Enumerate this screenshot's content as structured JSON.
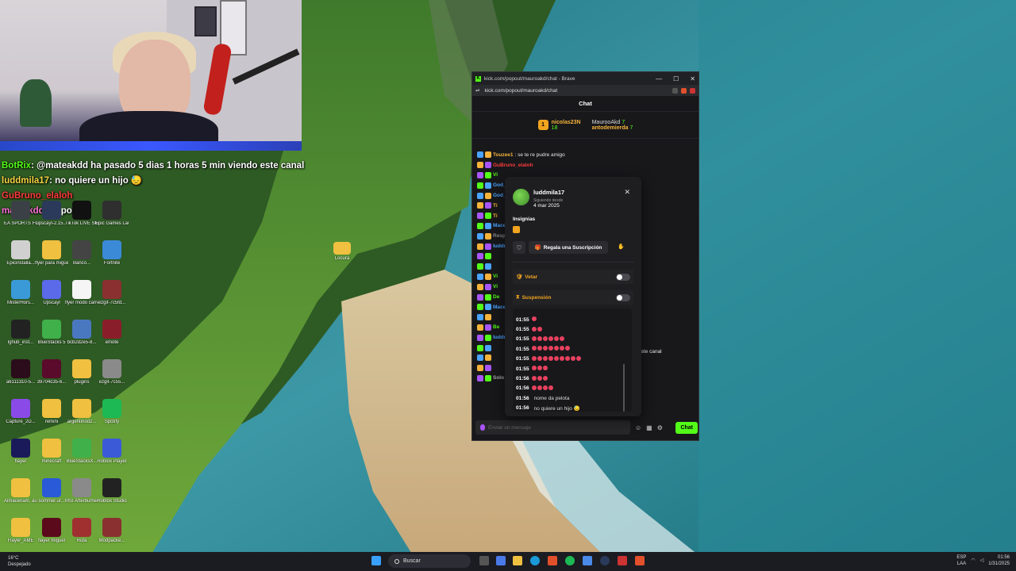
{
  "overlay_chat": [
    {
      "user": "BotRix",
      "text": ": @mateakdd ha pasado 5 dias 1 horas 5 min viendo este canal",
      "cls": "user-botrix"
    },
    {
      "user": "luddmila17",
      "text": ": no quiere un hijo 😓",
      "cls": "user-ludd"
    },
    {
      "user": "GuBruno_elaloh",
      "text": "",
      "cls": "user-bruno"
    },
    {
      "user": "mateakdd",
      "text": ": re pocco",
      "cls": "user-matea"
    }
  ],
  "desktop_icons": [
    {
      "label": "EA SPORTS FC 25",
      "color": "#3a4046"
    },
    {
      "label": "upscayl-2.15...",
      "color": "#2b3a5a"
    },
    {
      "label": "TikTok LIVE Studio",
      "color": "#111111"
    },
    {
      "label": "Epic Games Launcher",
      "color": "#2f2f2f"
    },
    {
      "label": "Epicinstalla...",
      "color": "#d0d0d0"
    },
    {
      "label": "flyer para miguel",
      "color": "#f0c040"
    },
    {
      "label": "Banco...",
      "color": "#444444"
    },
    {
      "label": "Fortnite",
      "color": "#3a8ad8"
    },
    {
      "label": "MisterHors...",
      "color": "#3a9ad8"
    },
    {
      "label": "Upscayl",
      "color": "#5a6ae8"
    },
    {
      "label": "flyer modo carrera",
      "color": "#f5f5f5"
    },
    {
      "label": "ezgif-7c5fd...",
      "color": "#8a3030"
    },
    {
      "label": "lghub_inst...",
      "color": "#222222"
    },
    {
      "label": "BlueStacks 5",
      "color": "#3fb04a"
    },
    {
      "label": "bcb2d2e5-8...",
      "color": "#4a78c0"
    },
    {
      "label": "emote",
      "color": "#8a1d2a"
    },
    {
      "label": "a6111310-5...",
      "color": "#2a0c1a"
    },
    {
      "label": "39704c35-6...",
      "color": "#5a0a2a"
    },
    {
      "label": "plugins",
      "color": "#f0c040"
    },
    {
      "label": "ezgif-7c55...",
      "color": "#8a8a8a"
    },
    {
      "label": "Capture_2D...",
      "color": "#8a4ae8"
    },
    {
      "label": "remini",
      "color": "#f0c040"
    },
    {
      "label": "argentinod2...",
      "color": "#f0c040"
    },
    {
      "label": "Spotify",
      "color": "#1db954"
    },
    {
      "label": "flayer",
      "color": "#1a1a5a"
    },
    {
      "label": "minecraft",
      "color": "#f0c040"
    },
    {
      "label": "BlueStacksX...",
      "color": "#3fb04a"
    },
    {
      "label": "Roblox Player",
      "color": "#3a5ad8"
    },
    {
      "label": "Almacenam. automatic...",
      "color": "#f0c040"
    },
    {
      "label": "sommer.ur...",
      "color": "#2a5ad8"
    },
    {
      "label": "MSI Afterburner",
      "color": "#8a8a8a"
    },
    {
      "label": "Roblox Studio",
      "color": "#222222"
    },
    {
      "label": "Flayer_AME",
      "color": "#f0c040"
    },
    {
      "label": "flayer miguel",
      "color": "#5a0a1a"
    },
    {
      "label": "Ruta",
      "color": "#a03030"
    },
    {
      "label": "Modpacke...",
      "color": "#8a3030"
    }
  ],
  "folder_label": "Locura",
  "browser": {
    "title": "kick.com/popout/mauroakd/chat - Brave",
    "logo": "K",
    "min": "—",
    "max": "☐",
    "close": "✕",
    "address": "kick.com/popout/mauroakd/chat",
    "tune_icon": "⇌",
    "chat_header": "Chat",
    "leader_rank": "1",
    "leader_name": "nicolas23N",
    "leader_count": "18",
    "second_name": "MaurooAkd",
    "second_count": "7",
    "third_name": "antodemierda",
    "third_count": "7"
  },
  "chat_messages": [
    {
      "user": "Touzee1",
      "text": ": se te re pudre amigo",
      "color": "#f5b33a"
    },
    {
      "user": "GuBruno_elaloh",
      "text": "",
      "color": "#ff3a3a"
    },
    {
      "user": "Vi",
      "text": "",
      "color": "#53fc18"
    },
    {
      "user": "God_anz",
      "text": "",
      "color": "#4aa3ff"
    },
    {
      "user": "God_anz",
      "text": "",
      "color": "#4aa3ff"
    },
    {
      "user": "Ti",
      "text": "",
      "color": "#f5b33a"
    },
    {
      "user": "Ti",
      "text": "",
      "color": "#f5b33a"
    },
    {
      "user": "Macelli",
      "text": "",
      "color": "#4aa3ff"
    },
    {
      "user": "Respo",
      "text": "",
      "color": "#888888"
    },
    {
      "user": "luddmi",
      "text": "",
      "color": "#4aa3ff"
    },
    {
      "user": "",
      "text": "",
      "color": "#4aa3ff"
    },
    {
      "user": "",
      "text": "",
      "color": "#f5b33a"
    },
    {
      "user": "Vi",
      "text": "",
      "color": "#53fc18"
    },
    {
      "user": "Vi",
      "text": "",
      "color": "#53fc18"
    },
    {
      "user": "De",
      "text": "",
      "color": "#53fc18"
    },
    {
      "user": "Macelli",
      "text": "",
      "color": "#4aa3ff"
    },
    {
      "user": "",
      "text": "",
      "color": "#4aa3ff"
    },
    {
      "user": "Be",
      "text": "",
      "color": "#53fc18"
    },
    {
      "user": "luddmi",
      "text": "",
      "color": "#4aa3ff"
    },
    {
      "user": "",
      "text": "",
      "color": "#f5b33a"
    },
    {
      "user": "",
      "text": "",
      "color": "#53fc18"
    },
    {
      "user": "",
      "text": "",
      "color": "#4aa3ff"
    },
    {
      "user": "Solo seg",
      "text": "",
      "color": "#aaaaaa"
    }
  ],
  "chat_extra": "este canal",
  "chat_input": {
    "placeholder": "Enviar un mensaje",
    "send": "Chat",
    "ico_emote": "☺",
    "ico_store": "▦",
    "ico_gear": "⚙"
  },
  "usercard": {
    "username": "luddmila17",
    "follow_label": "Siguiendo desde",
    "follow_date": "4 mar 2025",
    "close": "✕",
    "badges_title": "Insignias",
    "heart": "♡",
    "gift_icon": "🎁",
    "gift_label": "Regala una Suscripción",
    "hand": "✋",
    "ban_label": "Vetar",
    "ban_icon": "🛡",
    "timeout_label": "Suspensión",
    "timeout_icon": "⧗",
    "history": [
      {
        "time": "01:55",
        "emotes": 1,
        "text": ""
      },
      {
        "time": "01:55",
        "emotes": 2,
        "text": ""
      },
      {
        "time": "01:55",
        "emotes": 6,
        "text": ""
      },
      {
        "time": "01:55",
        "emotes": 7,
        "text": ""
      },
      {
        "time": "01:55",
        "emotes": 9,
        "text": ""
      },
      {
        "time": "01:55",
        "emotes": 3,
        "text": ""
      },
      {
        "time": "01:56",
        "emotes": 3,
        "text": ""
      },
      {
        "time": "01:56",
        "emotes": 4,
        "text": ""
      },
      {
        "time": "01:56",
        "emotes": 0,
        "text": "nome da pelota"
      },
      {
        "time": "01:56",
        "emotes": 0,
        "text": "no quiere un hijo 😓"
      }
    ]
  },
  "taskbar": {
    "weather_temp": "16°C",
    "weather_desc": "Despejado",
    "search": "Buscar",
    "lang1": "ESP",
    "lang2": "LAA",
    "time": "01:56",
    "date": "1/31/2025"
  }
}
